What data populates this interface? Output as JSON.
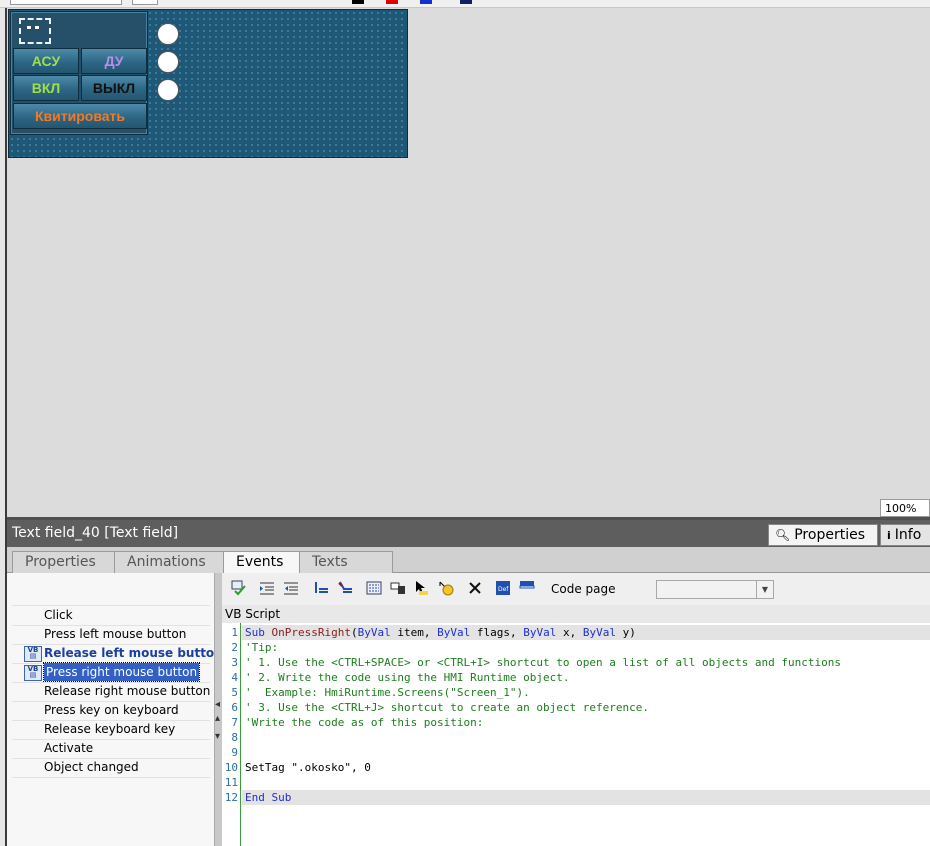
{
  "canvas": {
    "hmi_buttons": {
      "asu": "АСУ",
      "du": "ДУ",
      "vkl": "ВКЛ",
      "vykl": "ВЫКЛ",
      "kvit": "Квитировать"
    },
    "zoom": "100%"
  },
  "inspector": {
    "title": "Text field_40 [Text field]",
    "properties_tab": "Properties",
    "info_tab": "Info"
  },
  "tabs": [
    "Properties",
    "Animations",
    "Events",
    "Texts"
  ],
  "events": [
    "Click",
    "Press left mouse button",
    "Release left mouse button",
    "Press right mouse button",
    "Release right mouse button",
    "Press key on keyboard",
    "Release keyboard key",
    "Activate",
    "Object changed"
  ],
  "toolbar": {
    "code_page_label": "Code page",
    "code_page_value": ""
  },
  "editor": {
    "label": "VB Script",
    "line_numbers": [
      "1",
      "2",
      "3",
      "4",
      "5",
      "6",
      "7",
      "8",
      "9",
      "10",
      "11",
      "12"
    ],
    "lines": [
      "Sub OnPressRight(ByVal item, ByVal flags, ByVal x, ByVal y)",
      "'Tip:",
      "' 1. Use the <CTRL+SPACE> or <CTRL+I> shortcut to open a list of all objects and functions",
      "' 2. Write the code using the HMI Runtime object.",
      "'  Example: HmiRuntime.Screens(\"Screen_1\").",
      "' 3. Use the <CTRL+J> shortcut to create an object reference.",
      "'Write the code as of this position:",
      "",
      "",
      "SetTag \".okosko\", 0",
      "",
      "End Sub"
    ]
  },
  "colors": {
    "hmi_background": "#1f5777",
    "asu_text": "#9fe04a",
    "du_text": "#b88ee8",
    "vkl_text": "#9fe04a",
    "vykl_text": "#111111",
    "kvit_text": "#f07a26",
    "selected_event": "#3260c4"
  }
}
